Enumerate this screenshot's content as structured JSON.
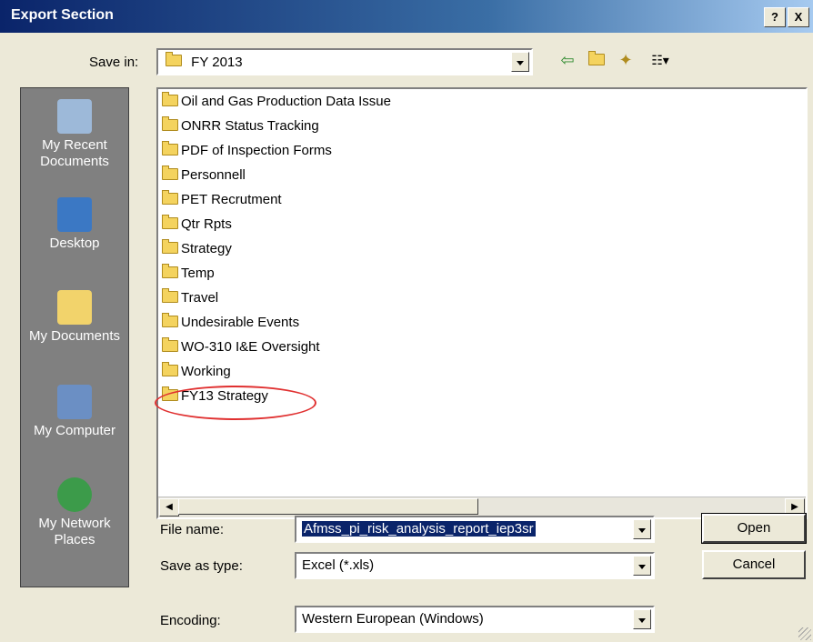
{
  "window": {
    "title": "Export Section",
    "help_label": "?",
    "close_label": "X"
  },
  "save_in": {
    "label": "Save in:",
    "value": "FY 2013"
  },
  "places": [
    {
      "label": "My Recent Documents"
    },
    {
      "label": "Desktop"
    },
    {
      "label": "My Documents"
    },
    {
      "label": "My Computer"
    },
    {
      "label": "My Network Places"
    }
  ],
  "files": [
    "Oil and Gas Production Data Issue",
    "ONRR Status Tracking",
    "PDF of Inspection Forms",
    "Personnell",
    "PET Recrutment",
    "Qtr Rpts",
    "Strategy",
    "Temp",
    "Travel",
    "Undesirable Events",
    "WO-310 I&E Oversight",
    "Working",
    "FY13 Strategy"
  ],
  "file_name": {
    "label": "File name:",
    "value": "Afmss_pi_risk_analysis_report_iep3sr"
  },
  "save_as_type": {
    "label": "Save as type:",
    "value": "Excel (*.xls)"
  },
  "encoding": {
    "label": "Encoding:",
    "value": "Western European (Windows)"
  },
  "buttons": {
    "open": "Open",
    "cancel": "Cancel"
  },
  "icons": [
    "back-icon",
    "up-folder-icon",
    "new-folder-icon",
    "views-menu-icon"
  ],
  "colors": {
    "titlebar": "#0a246a",
    "highlight_circle": "#e03030",
    "selection": "#0a246a"
  }
}
